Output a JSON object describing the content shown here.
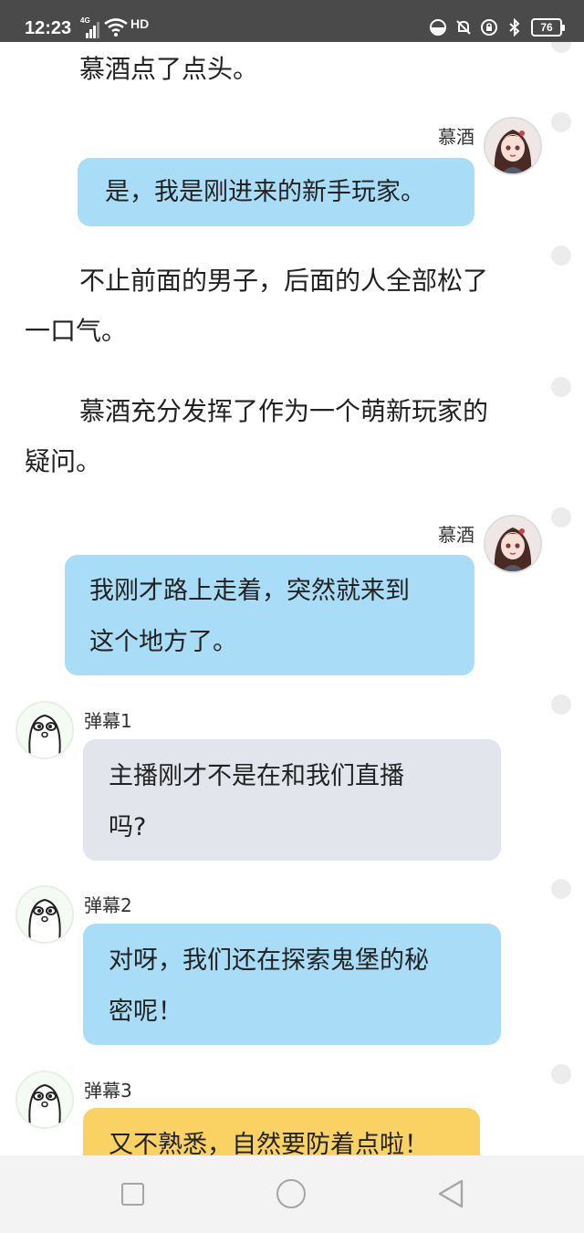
{
  "status_bar": {
    "time": "12:23",
    "network": "4G",
    "hd": "HD",
    "battery": "76"
  },
  "messages": [
    {
      "type": "narration",
      "text": "慕酒点了点头。"
    },
    {
      "type": "chat",
      "speaker": "慕酒",
      "side": "right",
      "bubble": "blue",
      "text": "是，我是刚进来的新手玩家。"
    },
    {
      "type": "narration",
      "line1": "不止前面的男子，后面的人全部松了",
      "line2": "一口气。"
    },
    {
      "type": "narration",
      "line1": "慕酒充分发挥了作为一个萌新玩家的",
      "line2": "疑问。"
    },
    {
      "type": "chat",
      "speaker": "慕酒",
      "side": "right",
      "bubble": "blue",
      "line1": "我刚才路上走着，突然就来到",
      "line2": "这个地方了。"
    },
    {
      "type": "chat",
      "speaker": "弹幕1",
      "side": "left",
      "bubble": "gray",
      "line1": "主播刚才不是在和我们直播",
      "line2": "吗?"
    },
    {
      "type": "chat",
      "speaker": "弹幕2",
      "side": "left",
      "bubble": "blue",
      "line1": "对呀，我们还在探索鬼堡的秘",
      "line2": "密呢！"
    },
    {
      "type": "chat",
      "speaker": "弹幕3",
      "side": "left",
      "bubble": "yellow",
      "text": "又不熟悉，自然要防着点啦！"
    }
  ],
  "colors": {
    "status_bar_bg": "#4a4a4a",
    "bubble_blue": "#a9dcf6",
    "bubble_gray": "#e2e6ec",
    "bubble_yellow": "#fad264",
    "nav_bg": "#f3f3f3"
  },
  "icons": {
    "avatar_speaker": "anime-girl-avatar",
    "avatar_danmu": "cute-face-avatar",
    "nav": [
      "square-recents-icon",
      "circle-home-icon",
      "triangle-back-icon"
    ]
  }
}
